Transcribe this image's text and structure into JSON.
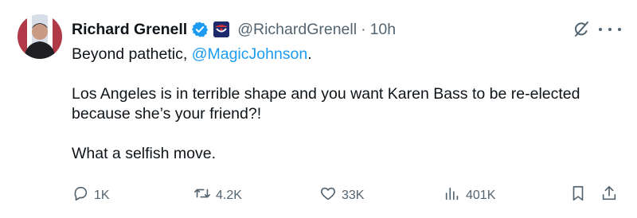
{
  "tweet": {
    "author_name": "Richard Grenell",
    "author_handle": "@RichardGrenell",
    "separator": "·",
    "time": "10h",
    "line1_prefix": "Beyond pathetic, ",
    "line1_mention": "@MagicJohnson",
    "line1_suffix": ".",
    "line2": "Los Angeles is in terrible shape and you want Karen Bass to be re-elected",
    "line3": "because she’s your friend?!",
    "line4": "What a selfish move."
  },
  "actions": {
    "replies": "1K",
    "reposts": "4.2K",
    "likes": "33K",
    "views": "401K"
  },
  "icons": {
    "verified": "verified-badge-icon",
    "affiliate": "affiliate-badge-icon",
    "grok": "grok-icon",
    "more": "more-icon",
    "reply": "reply-icon",
    "repost": "repost-icon",
    "like": "like-icon",
    "views": "views-icon",
    "bookmark": "bookmark-icon",
    "share": "share-icon"
  },
  "colors": {
    "text": "#0f1419",
    "muted": "#536471",
    "link": "#1d9bf0",
    "verified": "#1d9bf0"
  }
}
